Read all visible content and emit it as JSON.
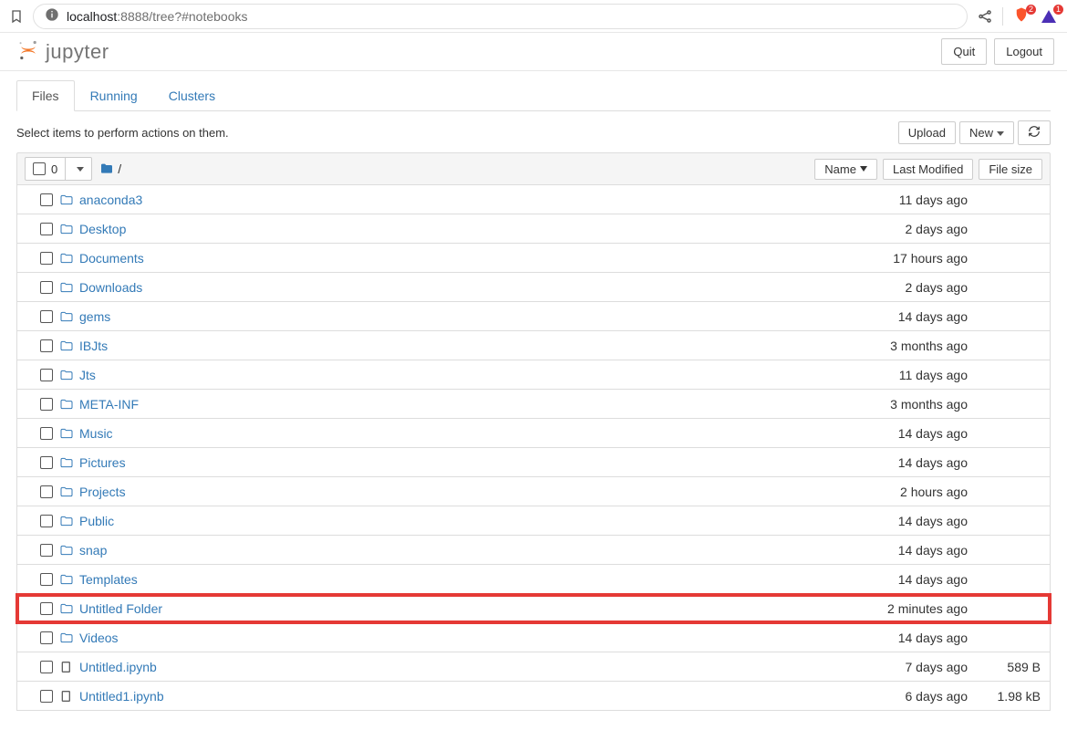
{
  "browser": {
    "host": "localhost",
    "port_path": ":8888/tree?#notebooks"
  },
  "header": {
    "logo_text": "jupyter",
    "quit_label": "Quit",
    "logout_label": "Logout"
  },
  "tabs": {
    "files": "Files",
    "running": "Running",
    "clusters": "Clusters"
  },
  "toolbar": {
    "hint": "Select items to perform actions on them.",
    "upload": "Upload",
    "new": "New"
  },
  "list_header": {
    "selected_count": "0",
    "breadcrumb_sep": "/",
    "name": "Name",
    "last_modified": "Last Modified",
    "file_size": "File size"
  },
  "items": [
    {
      "type": "folder",
      "name": "anaconda3",
      "modified": "11 days ago",
      "size": "",
      "highlight": false
    },
    {
      "type": "folder",
      "name": "Desktop",
      "modified": "2 days ago",
      "size": "",
      "highlight": false
    },
    {
      "type": "folder",
      "name": "Documents",
      "modified": "17 hours ago",
      "size": "",
      "highlight": false
    },
    {
      "type": "folder",
      "name": "Downloads",
      "modified": "2 days ago",
      "size": "",
      "highlight": false
    },
    {
      "type": "folder",
      "name": "gems",
      "modified": "14 days ago",
      "size": "",
      "highlight": false
    },
    {
      "type": "folder",
      "name": "IBJts",
      "modified": "3 months ago",
      "size": "",
      "highlight": false
    },
    {
      "type": "folder",
      "name": "Jts",
      "modified": "11 days ago",
      "size": "",
      "highlight": false
    },
    {
      "type": "folder",
      "name": "META-INF",
      "modified": "3 months ago",
      "size": "",
      "highlight": false
    },
    {
      "type": "folder",
      "name": "Music",
      "modified": "14 days ago",
      "size": "",
      "highlight": false
    },
    {
      "type": "folder",
      "name": "Pictures",
      "modified": "14 days ago",
      "size": "",
      "highlight": false
    },
    {
      "type": "folder",
      "name": "Projects",
      "modified": "2 hours ago",
      "size": "",
      "highlight": false
    },
    {
      "type": "folder",
      "name": "Public",
      "modified": "14 days ago",
      "size": "",
      "highlight": false
    },
    {
      "type": "folder",
      "name": "snap",
      "modified": "14 days ago",
      "size": "",
      "highlight": false
    },
    {
      "type": "folder",
      "name": "Templates",
      "modified": "14 days ago",
      "size": "",
      "highlight": false
    },
    {
      "type": "folder",
      "name": "Untitled Folder",
      "modified": "2 minutes ago",
      "size": "",
      "highlight": true
    },
    {
      "type": "folder",
      "name": "Videos",
      "modified": "14 days ago",
      "size": "",
      "highlight": false
    },
    {
      "type": "notebook",
      "name": "Untitled.ipynb",
      "modified": "7 days ago",
      "size": "589 B",
      "highlight": false
    },
    {
      "type": "notebook",
      "name": "Untitled1.ipynb",
      "modified": "6 days ago",
      "size": "1.98 kB",
      "highlight": false
    }
  ],
  "ext_badges": {
    "shield": "2",
    "triangle": "1"
  }
}
